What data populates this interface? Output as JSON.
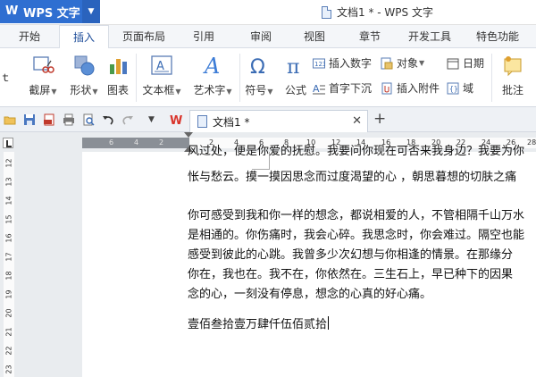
{
  "app": {
    "name": "WPS 文字",
    "window_title": "文档1 * - WPS 文字"
  },
  "tabs": [
    "开始",
    "插入",
    "页面布局",
    "引用",
    "审阅",
    "视图",
    "章节",
    "开发工具",
    "特色功能"
  ],
  "active_tab": "插入",
  "ribbon": {
    "group1": {
      "cut_label": "ｔ",
      "screenshot": "截屏",
      "shape": "形状",
      "chart": "图表"
    },
    "group2": {
      "textbox": "文本框",
      "arttext": "艺术字"
    },
    "group3": {
      "symbol": "符号",
      "formula": "公式"
    },
    "small": {
      "insert_number": "插入数字",
      "object": "对象",
      "date": "日期",
      "drop_cap": "首字下沉",
      "attachment": "插入附件",
      "field": "域"
    },
    "annotation": "批注"
  },
  "doc_tab": {
    "title": "文档1 *"
  },
  "hruler_numbers": [
    "6",
    "4",
    "2",
    "2",
    "4",
    "6",
    "8",
    "10",
    "12",
    "14",
    "16",
    "18",
    "20",
    "22",
    "24",
    "26",
    "28"
  ],
  "vruler_numbers": [
    "12",
    "13",
    "14",
    "15",
    "16",
    "17",
    "18",
    "19",
    "20",
    "21",
    "22",
    "23"
  ],
  "document": {
    "lines": [
      "风过处，便是你爱的抚慰。我要问你现在可否来我身边？我要为你",
      "怅与愁云。摸一摸因思念而过度渴望的心 ，朝思暮想的切肤之痛",
      "",
      "你可感受到我和你一样的想念，都说相爱的人，不管相隔千山万水",
      "是相通的。你伤痛时，我会心碎。我思念时，你会难过。隔空也能",
      "感受到彼此的心跳。我曾多少次幻想与你相逢的情景。在那缘分",
      "你在，我也在。我不在，你依然在。三生石上，早已种下的因果",
      "念的心，一刻没有停息，想念的心真的好心痛。",
      "",
      "壹佰叁拾壹万肆仟伍佰贰拾"
    ]
  }
}
